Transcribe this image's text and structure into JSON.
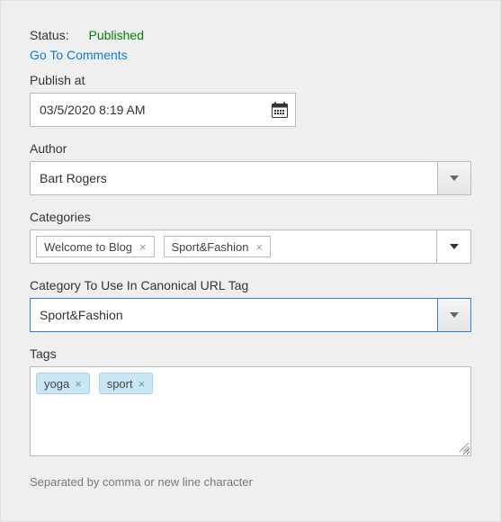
{
  "status": {
    "label": "Status:",
    "value": "Published"
  },
  "comments_link": "Go To Comments",
  "publish_at": {
    "label": "Publish at",
    "value": "03/5/2020 8:19 AM"
  },
  "author": {
    "label": "Author",
    "value": "Bart Rogers"
  },
  "categories": {
    "label": "Categories",
    "items": [
      {
        "label": "Welcome to Blog"
      },
      {
        "label": "Sport&Fashion"
      }
    ]
  },
  "canonical": {
    "label": "Category To Use In Canonical URL Tag",
    "value": "Sport&Fashion"
  },
  "tags": {
    "label": "Tags",
    "items": [
      {
        "label": "yoga"
      },
      {
        "label": "sport"
      }
    ],
    "help": "Separated by comma or new line character"
  }
}
